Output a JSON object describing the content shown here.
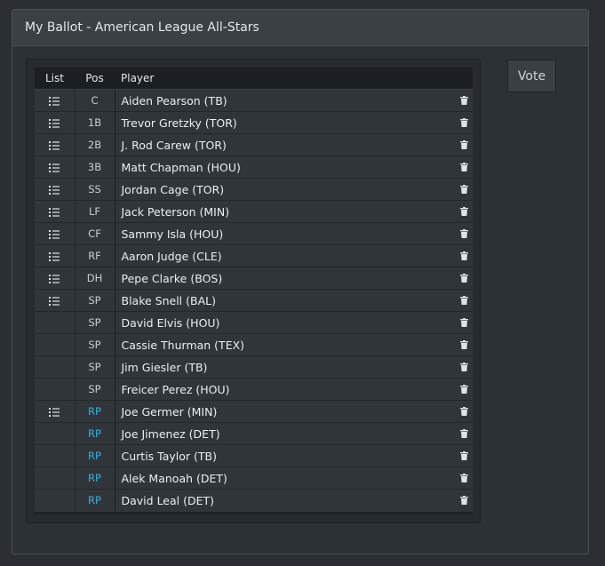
{
  "panel": {
    "title": "My Ballot - American League All-Stars"
  },
  "vote_button": {
    "label": "Vote"
  },
  "table": {
    "headers": {
      "list": "List",
      "pos": "Pos",
      "player": "Player"
    },
    "rows": [
      {
        "has_list": true,
        "pos": "C",
        "player": "Aiden Pearson (TB)"
      },
      {
        "has_list": true,
        "pos": "1B",
        "player": "Trevor Gretzky (TOR)"
      },
      {
        "has_list": true,
        "pos": "2B",
        "player": "J. Rod Carew (TOR)"
      },
      {
        "has_list": true,
        "pos": "3B",
        "player": "Matt Chapman (HOU)"
      },
      {
        "has_list": true,
        "pos": "SS",
        "player": "Jordan Cage (TOR)"
      },
      {
        "has_list": true,
        "pos": "LF",
        "player": "Jack Peterson (MIN)"
      },
      {
        "has_list": true,
        "pos": "CF",
        "player": "Sammy Isla (HOU)"
      },
      {
        "has_list": true,
        "pos": "RF",
        "player": "Aaron Judge (CLE)"
      },
      {
        "has_list": true,
        "pos": "DH",
        "player": "Pepe Clarke (BOS)"
      },
      {
        "has_list": true,
        "pos": "SP",
        "player": "Blake Snell (BAL)"
      },
      {
        "has_list": false,
        "pos": "SP",
        "player": "David Elvis (HOU)"
      },
      {
        "has_list": false,
        "pos": "SP",
        "player": "Cassie Thurman (TEX)"
      },
      {
        "has_list": false,
        "pos": "SP",
        "player": "Jim Giesler (TB)"
      },
      {
        "has_list": false,
        "pos": "SP",
        "player": "Freicer Perez (HOU)"
      },
      {
        "has_list": true,
        "pos": "RP",
        "player": "Joe Germer (MIN)"
      },
      {
        "has_list": false,
        "pos": "RP",
        "player": "Joe Jimenez (DET)"
      },
      {
        "has_list": false,
        "pos": "RP",
        "player": "Curtis Taylor (TB)"
      },
      {
        "has_list": false,
        "pos": "RP",
        "player": "Alek Manoah (DET)"
      },
      {
        "has_list": false,
        "pos": "RP",
        "player": "David Leal (DET)"
      }
    ]
  },
  "icons": {
    "list": "list-icon",
    "delete": "trash-icon"
  },
  "colors": {
    "rp_position": "#35b0e0"
  }
}
